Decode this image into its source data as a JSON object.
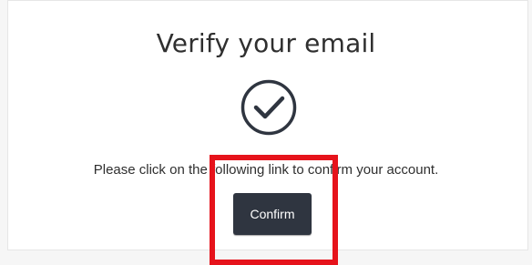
{
  "header": {
    "title": "Verify your email"
  },
  "content": {
    "icon": "check-circle-icon",
    "message": "Please click on the following link to confirm your account."
  },
  "actions": {
    "confirm_label": "Confirm"
  },
  "annotation": {
    "color": "#e6131b"
  },
  "colors": {
    "button_bg": "#2f3540",
    "text": "#2f2f2f",
    "icon": "#2f3540"
  }
}
